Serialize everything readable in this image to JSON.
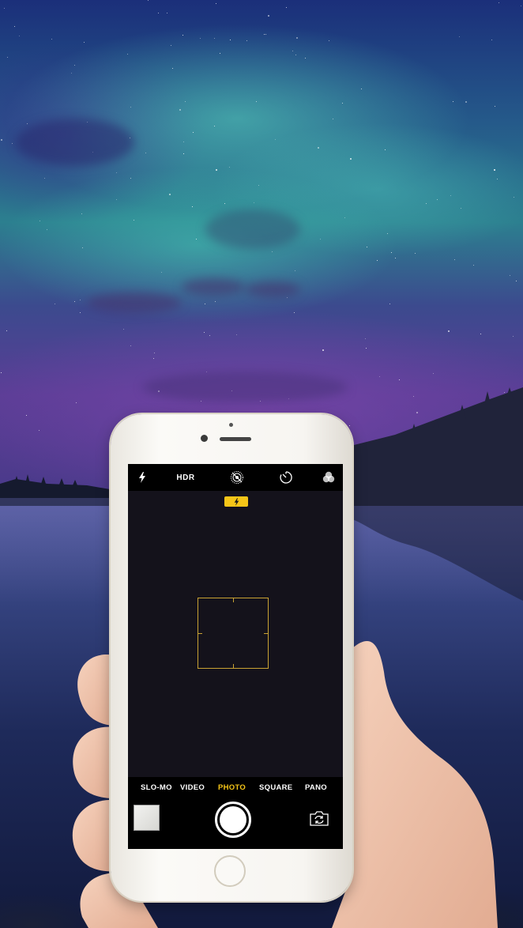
{
  "camera": {
    "top_bar": {
      "flash_icon": "flash-icon",
      "hdr_label": "HDR",
      "live_photo_icon": "live-photo-off-icon",
      "timer_icon": "timer-icon",
      "filters_icon": "filters-icon"
    },
    "flash_indicator_icon": "flash-icon",
    "modes": [
      "SLO-MO",
      "VIDEO",
      "PHOTO",
      "SQUARE",
      "PANO"
    ],
    "active_mode": "PHOTO",
    "accent_color": "#f5c518",
    "focus_color": "#c8a233"
  }
}
